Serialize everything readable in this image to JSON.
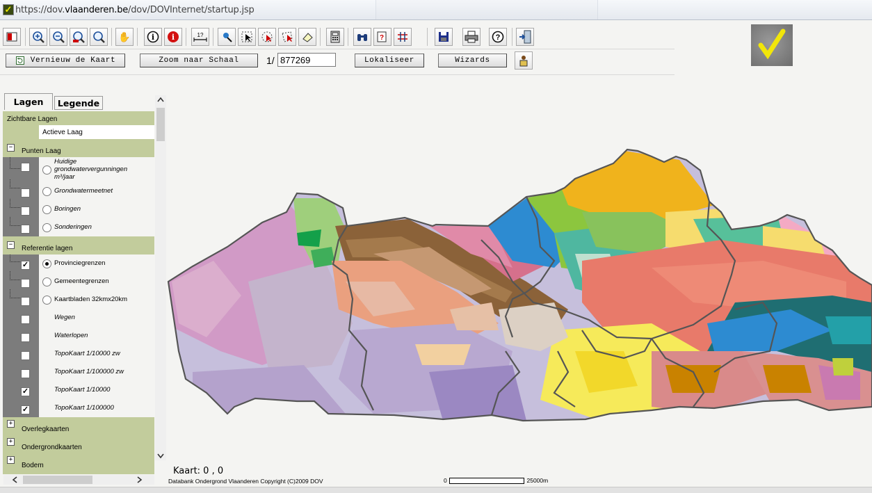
{
  "address_bar": {
    "url_prefix": "https://dov.",
    "url_domain": "vlaanderen.be",
    "url_path": "/dov/DOVInternet/startup.jsp"
  },
  "toolbar": {
    "icons": [
      "layer-toggle-icon",
      "zoom-in-icon",
      "zoom-out-icon",
      "zoom-full-icon",
      "zoom-select-icon",
      "pan-hand-icon",
      "info-icon",
      "info-red-icon",
      "measure-icon",
      "identify-icon",
      "select-arrow-icon",
      "select-circle-icon",
      "select-polygon-icon",
      "eraser-icon",
      "calculator-icon",
      "binoculars-icon",
      "query-icon",
      "grid-icon",
      "save-icon",
      "print-icon",
      "help-icon",
      "exit-icon"
    ]
  },
  "row2": {
    "refresh_label": "Vernieuw de Kaart",
    "zoom_scale_label": "Zoom naar Schaal",
    "scale_prefix": "1/",
    "scale_value": "877269",
    "localize_label": "Lokaliseer",
    "wizards_label": "Wizards"
  },
  "tabs": {
    "layers": "Lagen",
    "legend": "Legende"
  },
  "layers": {
    "visible_header": "Zichtbare Lagen",
    "active_layer": "Actieve Laag",
    "groups": {
      "points": "Punten Laag",
      "reference": "Referentie lagen",
      "overlay": "Overlegkaarten",
      "underground": "Ondergrondkaarten",
      "soil": "Bodem"
    },
    "point_items": [
      {
        "label": "Huidige grondwatervergunningen m³/jaar",
        "checked": false
      },
      {
        "label": "Grondwatermeetnet",
        "checked": false
      },
      {
        "label": "Boringen",
        "checked": false
      },
      {
        "label": "Sonderingen",
        "checked": false
      }
    ],
    "reference_items": [
      {
        "label": "Provinciegrenzen",
        "checked": true,
        "active": true
      },
      {
        "label": "Gemeentegrenzen",
        "checked": false
      },
      {
        "label": "Kaartbladen 32kmx20km",
        "checked": false
      },
      {
        "label": "Wegen",
        "checked": false
      },
      {
        "label": "Waterlopen",
        "checked": false
      },
      {
        "label": "TopoKaart 1/10000 zw",
        "checked": false
      },
      {
        "label": "TopoKaart 1/100000 zw",
        "checked": false
      },
      {
        "label": "TopoKaart 1/10000",
        "checked": true
      },
      {
        "label": "TopoKaart 1/100000",
        "checked": true
      }
    ]
  },
  "map": {
    "coords_label": "Kaart: 0 , 0",
    "copyright": "Databank Ondergrond Vlaanderen Copyright (C)2009 DOV",
    "scale_start": "0",
    "scale_end": "25000m",
    "colors": {
      "province_border": "#555555",
      "brown": "#8b6239",
      "lavender": "#c6bfdc",
      "pink": "#d19ac6",
      "salmon": "#e87a6a",
      "green_yellow": "#8cc63e",
      "orange": "#f0b31c",
      "teal": "#4fb7a0",
      "blue": "#2d8bd1",
      "dark_teal": "#1f6e72",
      "yellow": "#f6ea5a"
    }
  }
}
